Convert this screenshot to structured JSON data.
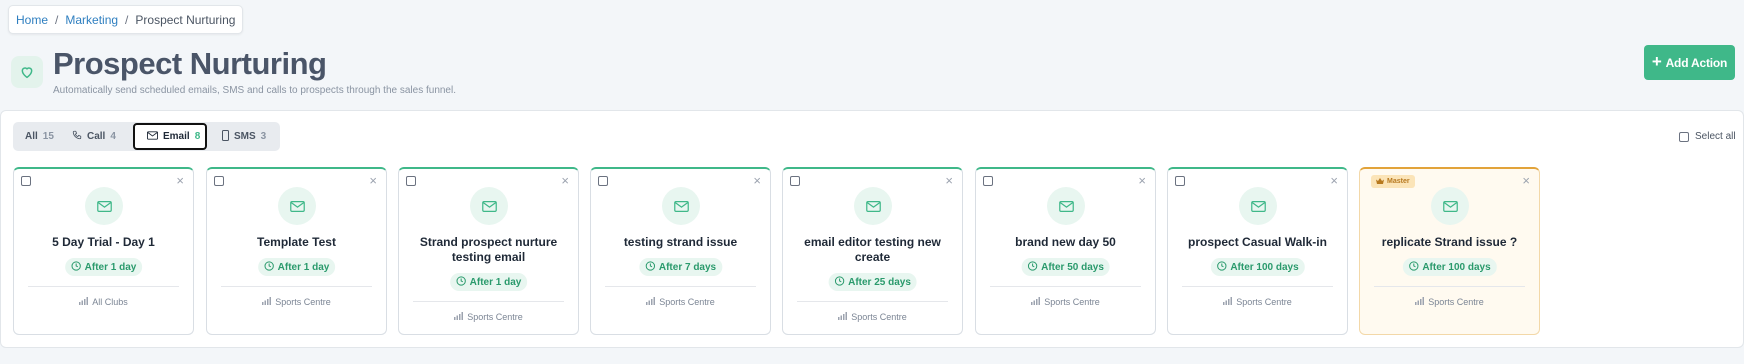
{
  "breadcrumb": {
    "home": "Home",
    "sep1": "/",
    "marketing": "Marketing",
    "sep2": "/",
    "current": "Prospect Nurturing"
  },
  "header": {
    "icon": "heart-icon",
    "title": "Prospect Nurturing",
    "subtitle": "Automatically send scheduled emails, SMS and calls to prospects through the sales funnel.",
    "add_action_label": "Add Action",
    "add_action_icon": "+"
  },
  "tabs": [
    {
      "label": "All",
      "count": "15",
      "icon": ""
    },
    {
      "label": "Call",
      "count": "4",
      "icon": "phone-icon"
    },
    {
      "label": "Email",
      "count": "8",
      "icon": "mail-icon",
      "active": true
    },
    {
      "label": "SMS",
      "count": "3",
      "icon": "mobile-icon"
    }
  ],
  "select_all_label": "Select all",
  "cards": [
    {
      "title": "5 Day Trial - Day 1",
      "delay": "After 1 day",
      "club": "All Clubs"
    },
    {
      "title": "Template Test",
      "delay": "After 1 day",
      "club": "Sports Centre"
    },
    {
      "title": "Strand prospect nurture testing email",
      "delay": "After 1 day",
      "club": "Sports Centre"
    },
    {
      "title": "testing strand issue",
      "delay": "After 7 days",
      "club": "Sports Centre"
    },
    {
      "title": "email editor testing new create",
      "delay": "After 25 days",
      "club": "Sports Centre"
    },
    {
      "title": "brand new day 50",
      "delay": "After 50 days",
      "club": "Sports Centre"
    },
    {
      "title": "prospect Casual Walk-in",
      "delay": "After 100 days",
      "club": "Sports Centre"
    },
    {
      "title": "replicate Strand issue ?",
      "delay": "After 100 days",
      "club": "Sports Centre",
      "badge": "Master"
    }
  ],
  "close_glyph": "×",
  "colors": {
    "accent": "#3fb889",
    "master": "#e2a33a",
    "link": "#2f7fc0"
  }
}
